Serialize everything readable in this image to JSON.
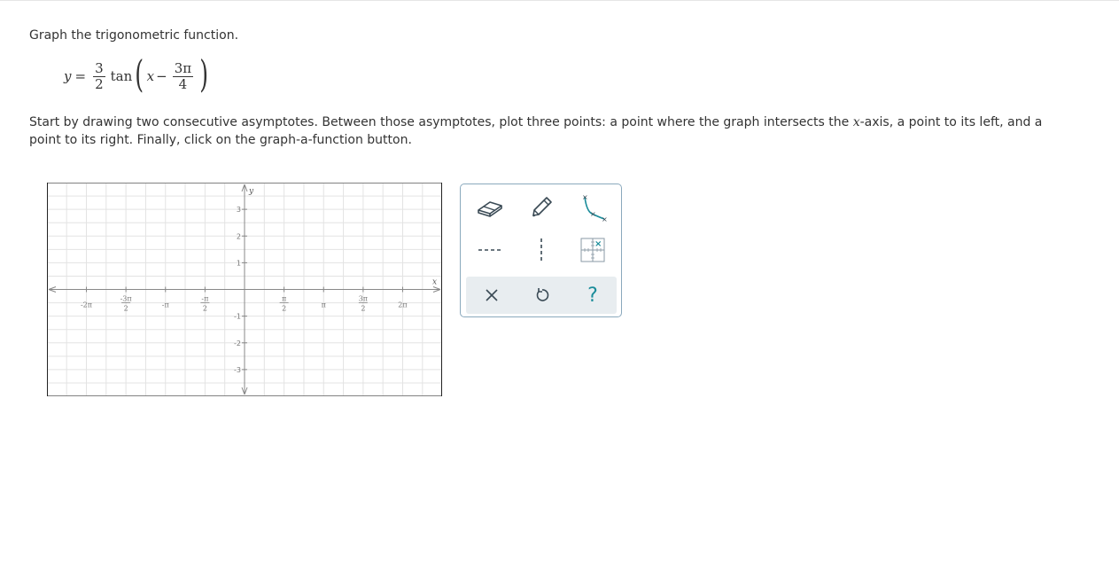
{
  "prompt": "Graph the trigonometric function.",
  "equation": {
    "lhs": "y",
    "equals": "=",
    "coef_num": "3",
    "coef_den": "2",
    "func": "tan",
    "arg_var": "x",
    "minus": "−",
    "shift_num": "3π",
    "shift_den": "4",
    "open_paren": "(",
    "close_paren": ")"
  },
  "instructions": {
    "part1": "Start by drawing two consecutive asymptotes. Between those asymptotes, plot three points: a point where the graph intersects the ",
    "xvar": "x",
    "part2": "-axis, a point to its left, and a point to its right. Finally, click on the graph-a-function button."
  },
  "graph": {
    "x_axis_label": "x",
    "y_axis_label": "y",
    "x_ticks": [
      {
        "value": -6.2832,
        "label": "-2π"
      },
      {
        "value": -4.7124,
        "num": "-3π",
        "den": "2"
      },
      {
        "value": -3.1416,
        "label": "-π"
      },
      {
        "value": -1.5708,
        "num": "-π",
        "den": "2"
      },
      {
        "value": 1.5708,
        "num": "π",
        "den": "2"
      },
      {
        "value": 3.1416,
        "label": "π"
      },
      {
        "value": 4.7124,
        "num": "3π",
        "den": "2"
      },
      {
        "value": 6.2832,
        "label": "2π"
      }
    ],
    "y_ticks": [
      {
        "value": 3,
        "label": "3"
      },
      {
        "value": 2,
        "label": "2"
      },
      {
        "value": 1,
        "label": "1"
      },
      {
        "value": -1,
        "label": "-1"
      },
      {
        "value": -2,
        "label": "-2"
      },
      {
        "value": -3,
        "label": "-3"
      }
    ],
    "x_range": [
      -7.85,
      7.85
    ],
    "y_range": [
      -4,
      4
    ],
    "grid": true
  },
  "tools": {
    "eraser": "eraser-icon",
    "pencil": "pencil-icon",
    "curve": "tangent-curve-icon",
    "horizontal_asymptote": "horizontal-dashed-line-icon",
    "vertical_asymptote": "vertical-dashed-line-icon",
    "graph_function": "graph-function-icon"
  },
  "actions": {
    "clear": "×",
    "undo": "undo-icon",
    "help": "?"
  },
  "colors": {
    "accent": "#1a8c9a",
    "icon": "#3a4a55"
  }
}
